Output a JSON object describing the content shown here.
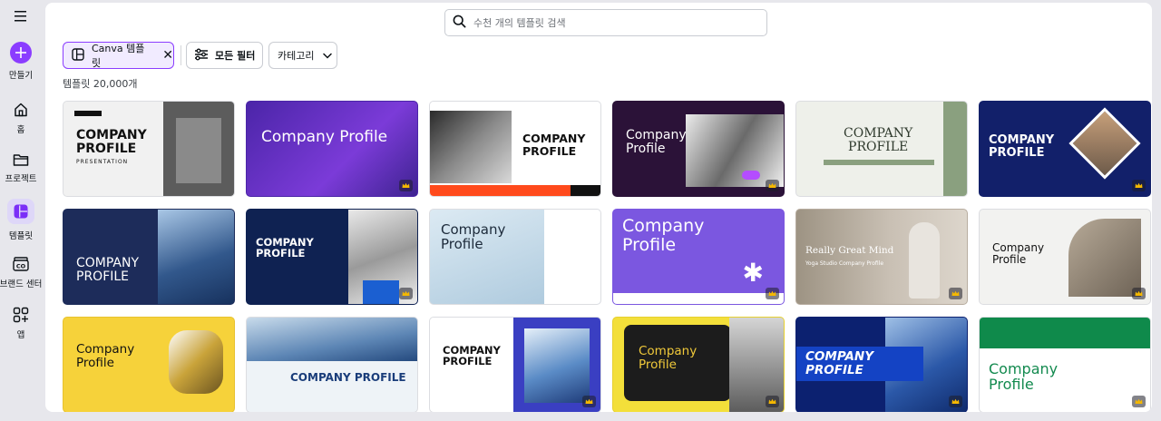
{
  "sidebar": {
    "items": [
      {
        "label": "만들기",
        "icon": "plus-icon"
      },
      {
        "label": "홈",
        "icon": "home-icon"
      },
      {
        "label": "프로젝트",
        "icon": "folder-icon"
      },
      {
        "label": "템플릿",
        "icon": "template-icon"
      },
      {
        "label": "브랜드 센터",
        "icon": "brand-icon"
      },
      {
        "label": "앱",
        "icon": "apps-icon"
      }
    ]
  },
  "search": {
    "placeholder": "수천 개의 템플릿 검색"
  },
  "filters": {
    "canva_label": "Canva 템플릿",
    "all_filters_label": "모든 필터",
    "category_label": "카테고리"
  },
  "results": {
    "count_label": "템플릿 20,000개"
  },
  "colors": {
    "accent": "#8b3dff",
    "accent_light": "#f1ebff",
    "panel": "#ffffff",
    "page_bg": "#e7e7ec"
  },
  "templates": [
    {
      "title": "COMPANY\nPROFILE",
      "subtitle": "PRESENTATION",
      "bg": "#f1f1f1",
      "fg": "#111111"
    },
    {
      "title": "Company Profile",
      "bg": "#5b2bb8",
      "fg": "#ffffff"
    },
    {
      "title": "COMPANY\nPROFILE",
      "bg": "#ffffff",
      "fg": "#111111"
    },
    {
      "title": "Company\nProfile",
      "bg": "#2b1238",
      "fg": "#ffffff"
    },
    {
      "title": "COMPANY\nPROFILE",
      "bg": "#eef0ea",
      "fg": "#2f3a2d"
    },
    {
      "title": "COMPANY\nPROFILE",
      "bg": "#12206a",
      "fg": "#ffffff"
    },
    {
      "title": "COMPANY\nPROFILE",
      "bg": "#1d2c5a",
      "fg": "#ffffff"
    },
    {
      "title": "COMPANY\nPROFILE",
      "bg": "#0f2252",
      "fg": "#ffffff"
    },
    {
      "title": "Company\nProfile",
      "bg": "#d8e6f0",
      "fg": "#1c2a3a"
    },
    {
      "title": "Company\nProfile",
      "bg": "#7b57e0",
      "fg": "#ffffff"
    },
    {
      "title": "Really Great Mind",
      "subtitle": "Yoga Studio Company Profile",
      "bg": "#b8ada0",
      "fg": "#ffffff"
    },
    {
      "title": "Company\nProfile",
      "bg": "#f2f2f0",
      "fg": "#111111"
    },
    {
      "title": "Company\nProfile",
      "bg": "#f6d23a",
      "fg": "#111111"
    },
    {
      "title": "COMPANY PROFILE",
      "bg": "#eef3f7",
      "fg": "#1a3d7a"
    },
    {
      "title": "COMPANY\nPROFILE",
      "bg": "#ffffff",
      "fg": "#111111"
    },
    {
      "title": "Company\nProfile",
      "bg": "#f3df3a",
      "fg": "#f0c93a"
    },
    {
      "title": "COMPANY\nPROFILE",
      "bg": "#0c2170",
      "fg": "#ffffff"
    },
    {
      "title": "Company\nProfile",
      "bg": "#ffffff",
      "fg": "#138a4f"
    }
  ]
}
